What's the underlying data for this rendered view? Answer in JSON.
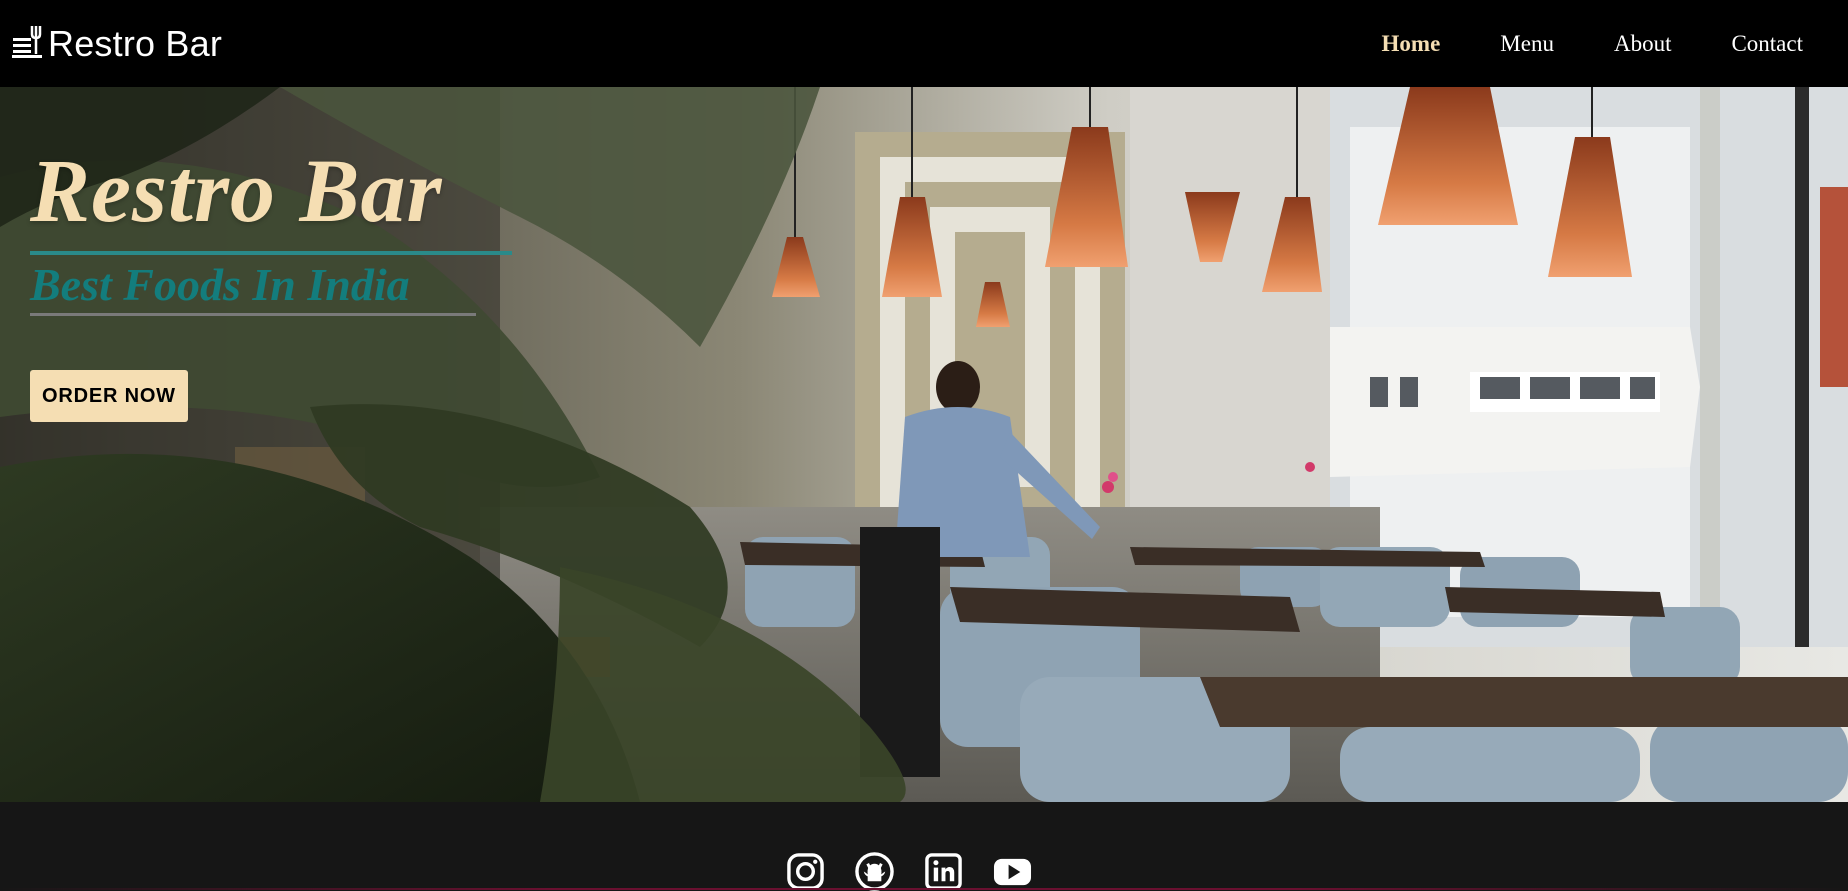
{
  "navbar": {
    "brand": "Restro Bar",
    "brand_icon": "fork-knife-icon",
    "links": [
      {
        "label": "Home",
        "active": true
      },
      {
        "label": "Menu",
        "active": false
      },
      {
        "label": "About",
        "active": false
      },
      {
        "label": "Contact",
        "active": false
      }
    ]
  },
  "hero": {
    "title": "Restro Bar",
    "subtitle": "Best Foods In India",
    "cta_label": "ORDER NOW",
    "background": "restaurant-interior-photo"
  },
  "footer": {
    "socials": [
      {
        "name": "instagram-icon"
      },
      {
        "name": "github-icon"
      },
      {
        "name": "linkedin-icon"
      },
      {
        "name": "youtube-icon"
      }
    ]
  },
  "colors": {
    "accent": "#f5deb3",
    "teal": "#137d7d",
    "navbar_bg": "#000000",
    "footer_bg": "#161616"
  }
}
